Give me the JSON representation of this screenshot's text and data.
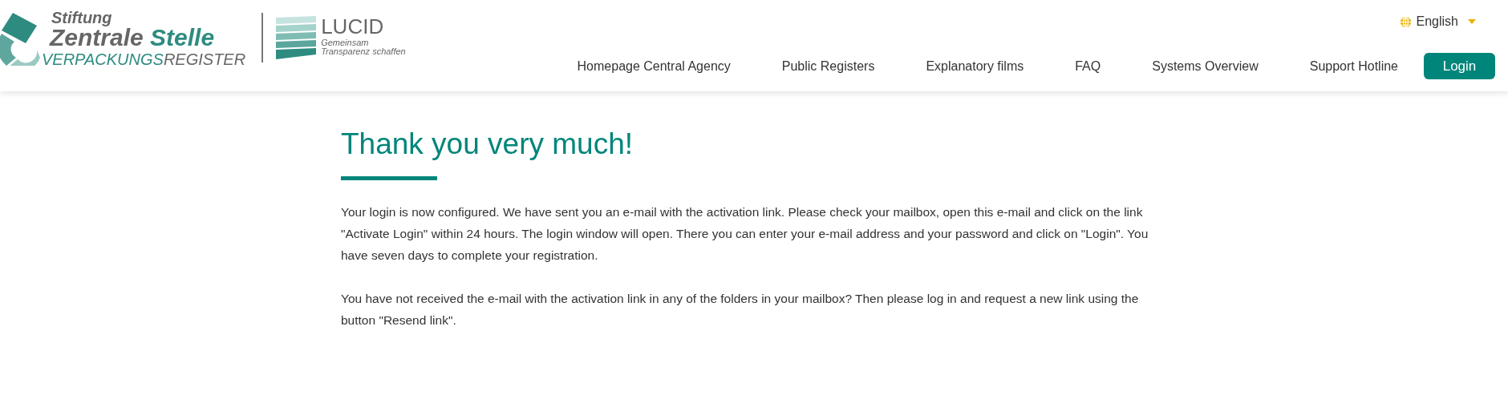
{
  "logo": {
    "line_1": "Stiftung",
    "line_2a": "Zentrale",
    "line_2b": "Stelle",
    "line_3a": "VERPACKUNGS",
    "line_3b": "REGISTER"
  },
  "partner_logo": {
    "name": "LUCID",
    "tagline_1": "Gemeinsam",
    "tagline_2": "Transparenz schaffen"
  },
  "language": {
    "label": "English"
  },
  "nav": [
    {
      "label": "Homepage Central Agency"
    },
    {
      "label": "Public Registers"
    },
    {
      "label": "Explanatory films"
    },
    {
      "label": "FAQ"
    },
    {
      "label": "Systems Overview"
    },
    {
      "label": "Support Hotline"
    }
  ],
  "login_button": "Login",
  "title": "Thank you very much!",
  "paragraphs": [
    "Your login is now configured. We have sent you an e-mail with the activation link. Please check your mailbox, open this e-mail and click on the link \"Activate Login\" within 24 hours. The login window will open. There you can enter your e-mail address and your password and click on \"Login\". You have seven days to complete your registration.",
    "You have not received the e-mail with the activation link in any of the folders in your mailbox? Then please log in and request a new link using the button \"Resend link\"."
  ]
}
